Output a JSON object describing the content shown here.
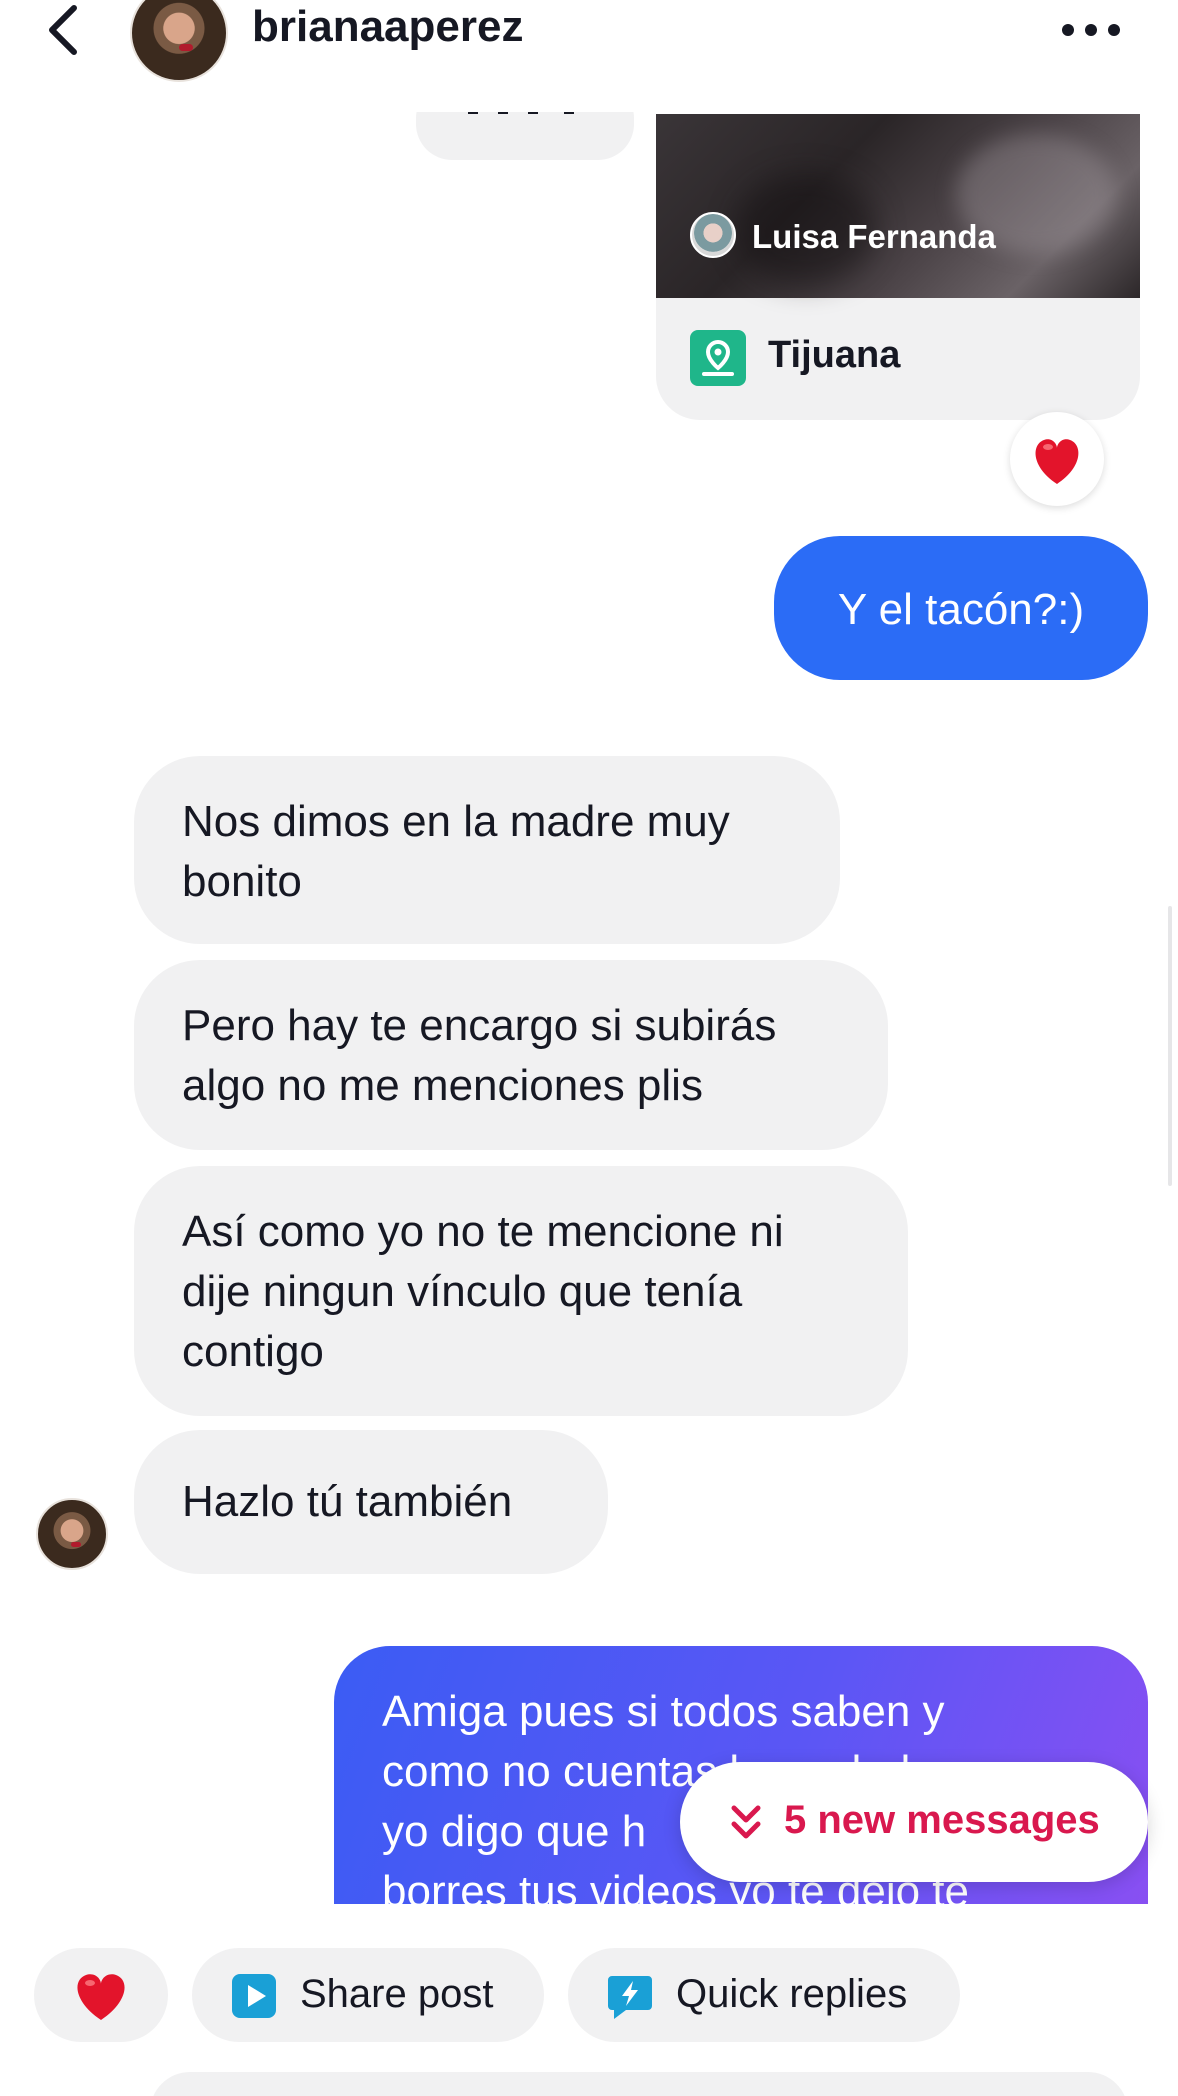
{
  "header": {
    "username": "brianaaperez"
  },
  "shared_post": {
    "author": "Luisa Fernanda",
    "location": "Tijuana",
    "reaction": "heart"
  },
  "messages": [
    {
      "from": "me",
      "text": "Y el tacón?:)"
    },
    {
      "from": "them",
      "text": "Nos dimos en la madre muy\nbonito"
    },
    {
      "from": "them",
      "text": "Pero hay te encargo si subirás\nalgo no me menciones plis"
    },
    {
      "from": "them",
      "text": "Así como yo no te mencione ni\ndije ningun vínculo que tenía\ncontigo"
    },
    {
      "from": "them",
      "text": "Hazlo tú también"
    },
    {
      "from": "me",
      "text": "Amiga pues si todos saben y\ncomo no cuentas la verdad pues\nyo digo que h\nborres tus videos yo te dejo te"
    }
  ],
  "new_messages": {
    "label": "5 new messages"
  },
  "bottom_bar": {
    "share_label": "Share post",
    "quick_label": "Quick replies"
  },
  "colors": {
    "outgoing": "#2b6cf6",
    "incoming": "#f1f1f2",
    "accent": "#d9184e",
    "location_pin": "#1fb68a"
  },
  "icons": [
    "back-arrow-icon",
    "more-icon",
    "location-pin-icon",
    "heart-icon",
    "share-post-icon",
    "quick-replies-icon",
    "double-chevron-down-icon"
  ]
}
